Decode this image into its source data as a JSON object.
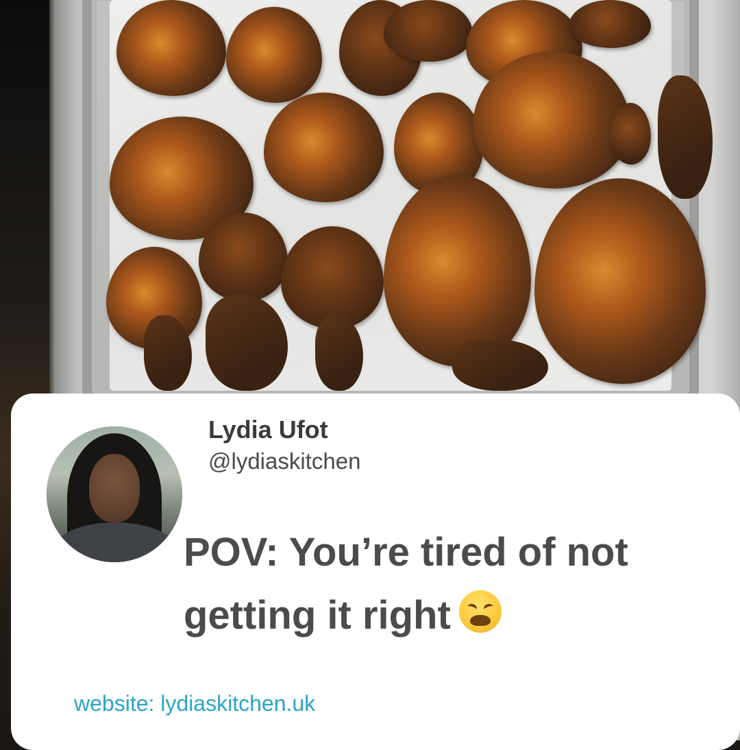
{
  "post": {
    "author_name": "Lydia Ufot",
    "author_handle": "@lydiaskitchen",
    "text": "POV: You’re tired of not getting it right",
    "emoji_name": "weary-face",
    "website_label": "website: lydiaskitchen.uk"
  },
  "colors": {
    "card_background": "#ffffff",
    "name_text": "#3a3a3a",
    "body_text": "#4b4b4b",
    "link_text": "#2aa5c8"
  },
  "photo": {
    "subject": "tray of fried dough puffs (puff-puff) on paper towel"
  }
}
